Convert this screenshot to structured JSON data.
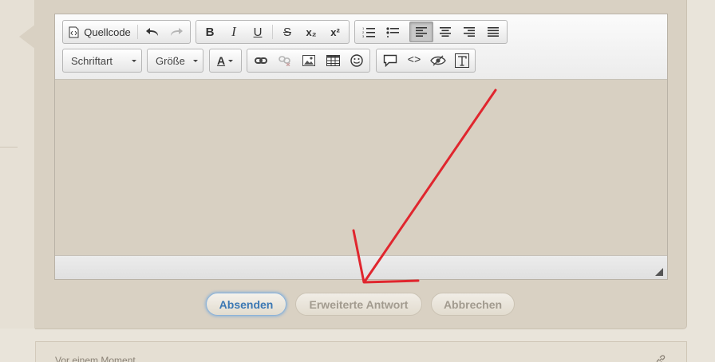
{
  "toolbar": {
    "source_label": "Quellcode",
    "font_label": "Schriftart",
    "size_label": "Größe",
    "text_color_glyph": "A",
    "bold_glyph": "B",
    "italic_glyph": "I",
    "underline_glyph": "U",
    "strike_glyph": "S",
    "subscript_glyph": "x₂",
    "superscript_glyph": "x²",
    "code_glyph": "<>",
    "icons": [
      "source-icon",
      "undo-icon",
      "redo-icon",
      "bold-icon",
      "italic-icon",
      "underline-icon",
      "strikethrough-icon",
      "subscript-icon",
      "superscript-icon",
      "numbered-list-icon",
      "bullet-list-icon",
      "align-left-icon",
      "align-center-icon",
      "align-right-icon",
      "justify-icon",
      "font-color-icon",
      "link-icon",
      "unlink-icon",
      "image-icon",
      "table-icon",
      "smiley-icon",
      "quote-icon",
      "code-icon",
      "preview-icon",
      "remove-format-icon"
    ]
  },
  "actions": {
    "submit_label": "Absenden",
    "advanced_label": "Erweiterte Antwort",
    "cancel_label": "Abbrechen"
  },
  "next_post": {
    "timestamp": "Vor einem Moment"
  },
  "colors": {
    "panel_bg": "#d9d1c3",
    "page_bg": "#e9e4da",
    "primary_text": "#3c78b4",
    "annotation_arrow": "#e0262e"
  }
}
